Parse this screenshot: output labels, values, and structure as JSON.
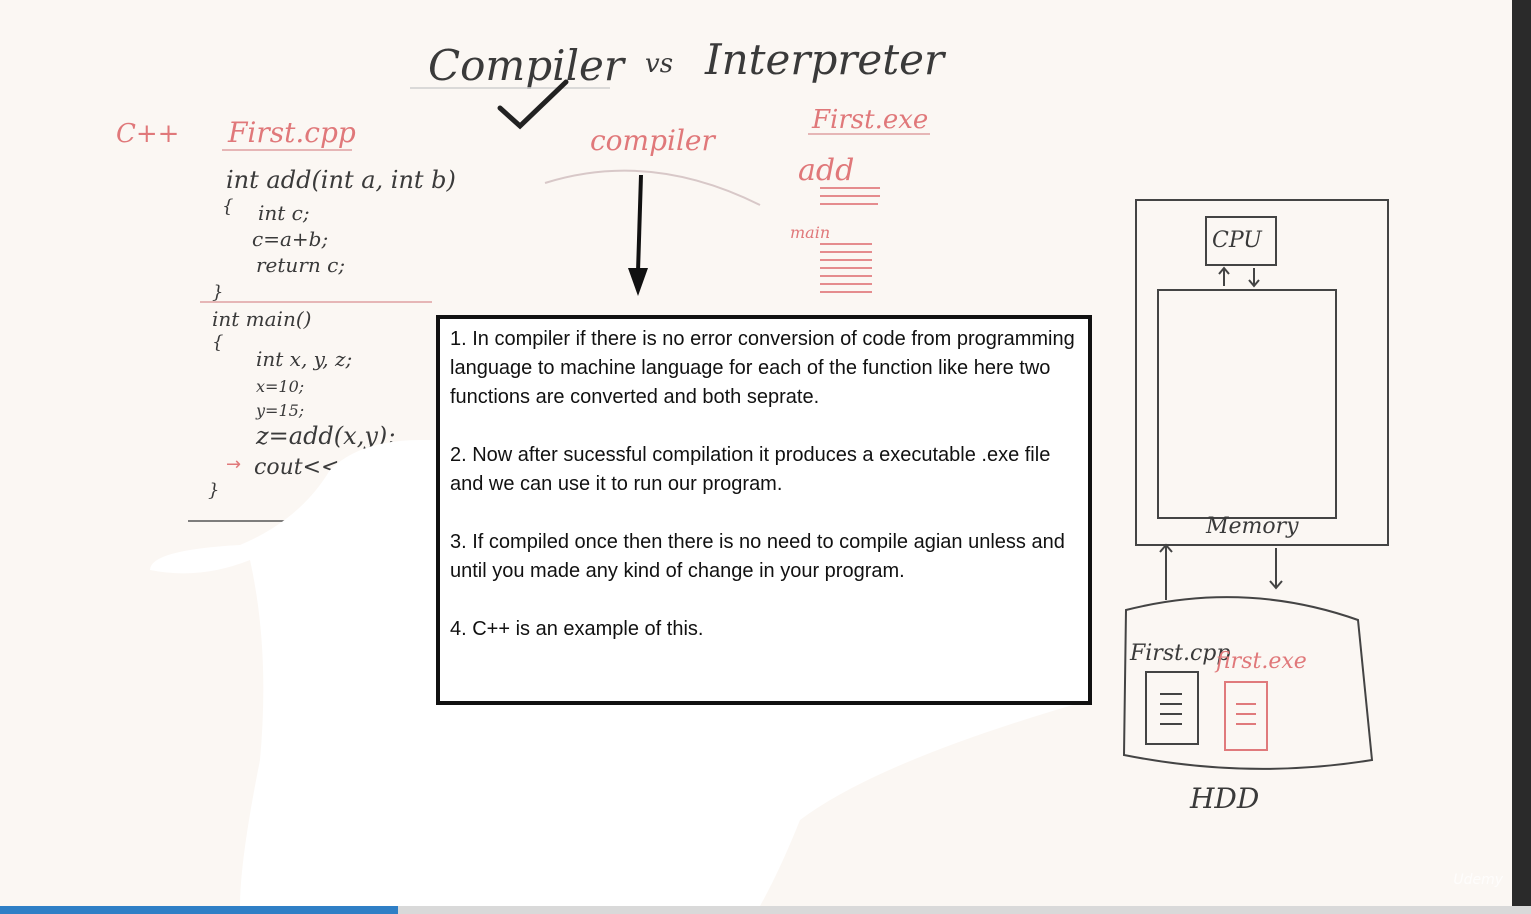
{
  "board": {
    "title_left": "Compiler",
    "title_vs": "vs",
    "title_right": "Interpreter",
    "lang_label": "C++",
    "source_file": "First.cpp",
    "compiler_label": "compiler",
    "output_file": "First.exe",
    "output_add": "add",
    "output_main": "main",
    "code_lines": [
      "int add(int a, int b)",
      "{",
      "int c;",
      "c=a+b;",
      "return c;",
      "}",
      "int main()",
      "{",
      "int x, y, z;",
      "x=10;",
      "y=15;",
      "z=add(x,y);",
      "cout<<z;",
      "}"
    ],
    "cpu_label": "CPU",
    "memory_label": "Memory",
    "hdd_label": "HDD",
    "hdd_file_cpp": "First.cpp",
    "hdd_file_exe": "first.exe"
  },
  "notes": [
    "1. In compiler if there is no error conversion of code from programming language to machine language for each of the function like here two functions are converted and both seprate.",
    "2. Now after sucessful compilation it produces a executable .exe file and we can use it to run our program.",
    "3. If compiled once then there is no need to compile agian unless and until you made any kind of change in your program.",
    "4. C++ is an example of this."
  ],
  "watermark": "Udemy",
  "colors": {
    "red_marker": "#e0787a",
    "black_marker": "#3a3a3a",
    "progress": "#2f7fc6"
  },
  "video_progress": 0.26
}
